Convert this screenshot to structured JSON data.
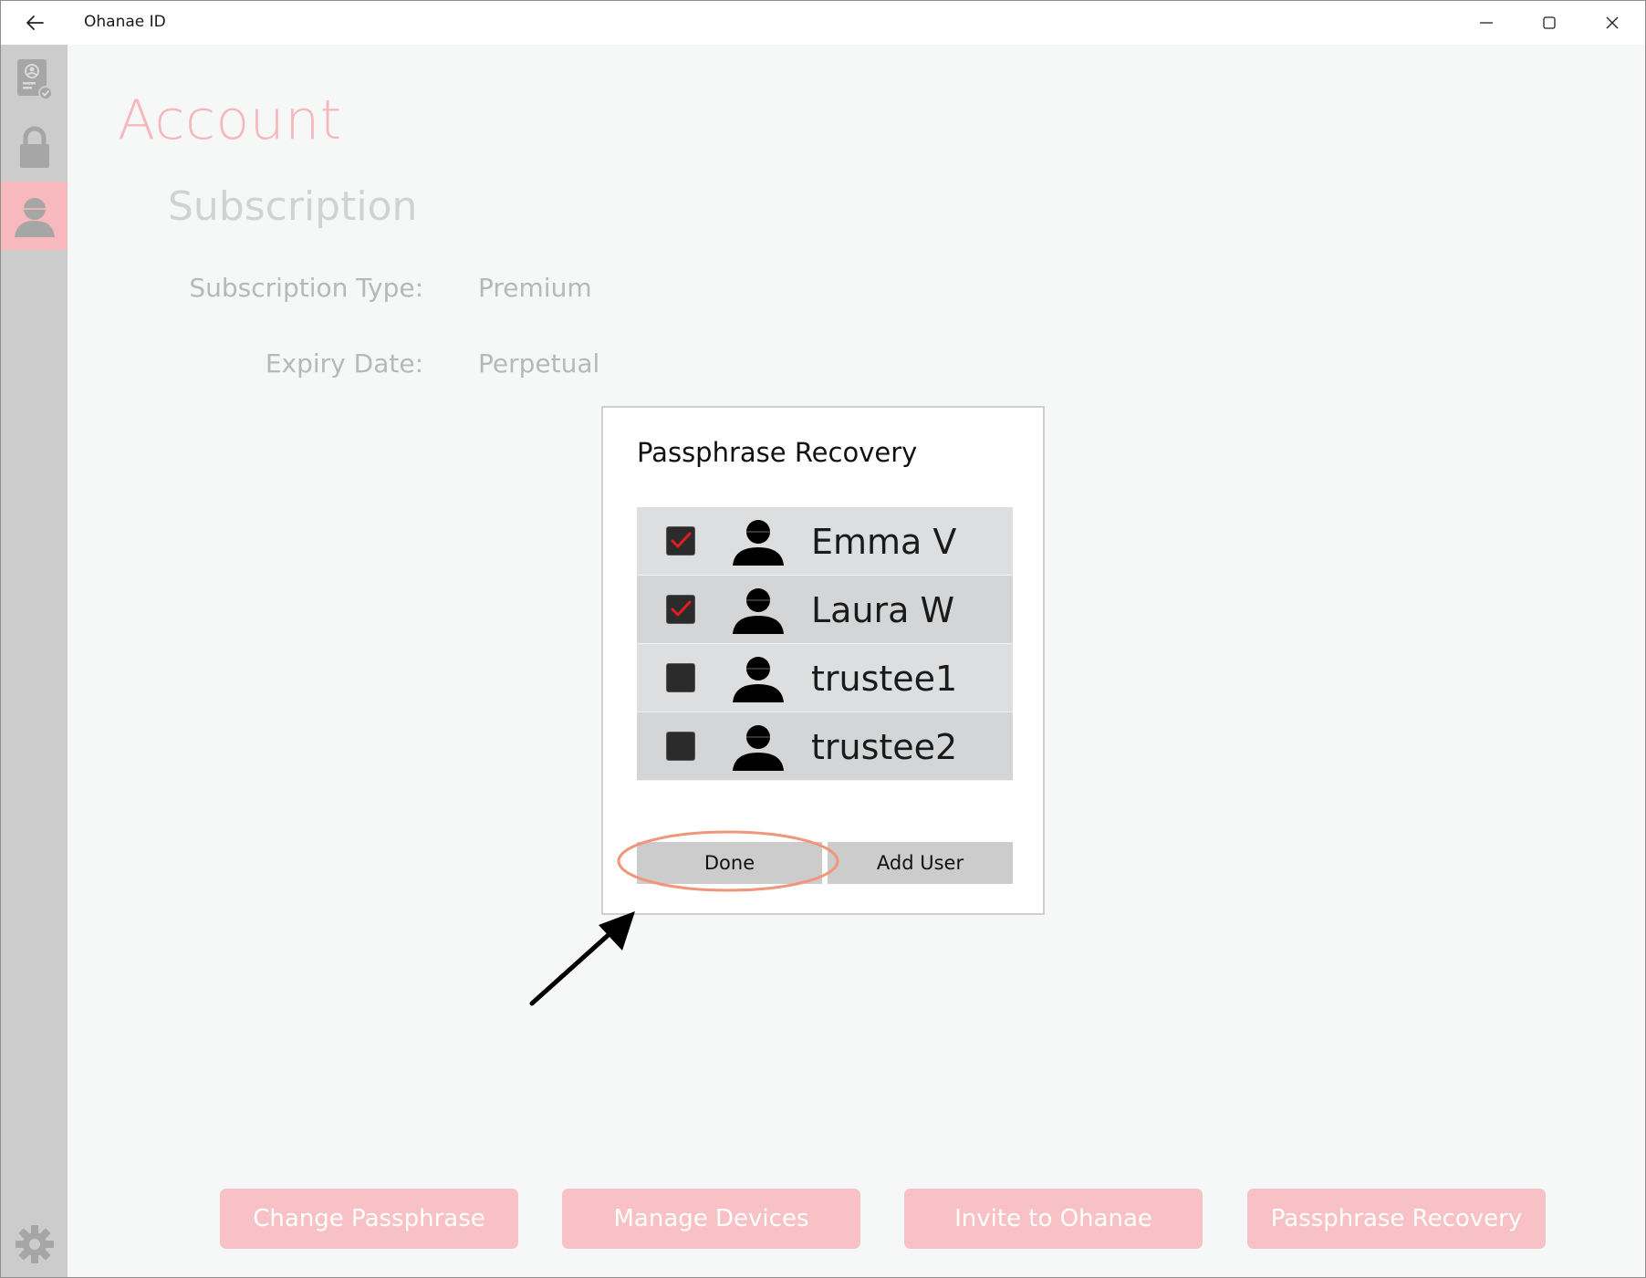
{
  "window": {
    "app_title": "Ohanae ID"
  },
  "sidebar": {
    "items": [
      {
        "icon": "id-card-icon"
      },
      {
        "icon": "lock-icon"
      },
      {
        "icon": "user-icon",
        "active": true
      }
    ],
    "bottom_icon": "gear-icon"
  },
  "page": {
    "title": "Account",
    "section": "Subscription",
    "fields": [
      {
        "label": "Subscription Type:",
        "value": "Premium"
      },
      {
        "label": "Expiry Date:",
        "value": "Perpetual"
      }
    ]
  },
  "dialog": {
    "title": "Passphrase Recovery",
    "users": [
      {
        "name": "Emma V",
        "checked": true
      },
      {
        "name": "Laura W",
        "checked": true
      },
      {
        "name": "trustee1",
        "checked": false
      },
      {
        "name": "trustee2",
        "checked": false
      }
    ],
    "done_label": "Done",
    "add_user_label": "Add User"
  },
  "bottom_buttons": [
    {
      "label": "Change Passphrase"
    },
    {
      "label": "Manage Devices"
    },
    {
      "label": "Invite to Ohanae"
    },
    {
      "label": "Passphrase Recovery"
    }
  ],
  "colors": {
    "accent": "#f7b9bd",
    "check": "#e31b23",
    "annotation_ellipse": "#f0967a"
  }
}
